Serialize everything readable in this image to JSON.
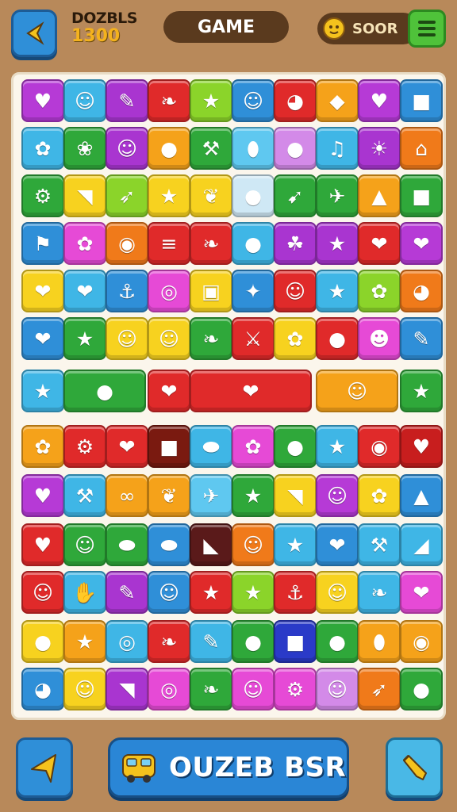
{
  "header": {
    "score_title": "DOZBLS",
    "score_value": "1300",
    "game_label": "GAME",
    "coin_label": "SOOR"
  },
  "footer": {
    "main_label": "OUZEB BSR"
  },
  "colors": {
    "background": "#b8895a",
    "board": "#fbf6ec",
    "primary_button": "#2a86d6",
    "menu_button": "#4fc23a"
  },
  "board": {
    "rows": [
      [
        {
          "c": "#b63ad6",
          "i": "heart"
        },
        {
          "c": "#3fb6e6",
          "i": "cat"
        },
        {
          "c": "#a935d0",
          "i": "pencil"
        },
        {
          "c": "#e02a2a",
          "i": "leaf"
        },
        {
          "c": "#8bd42a",
          "i": "star"
        },
        {
          "c": "#2f8fd8",
          "i": "face"
        },
        {
          "c": "#e02a2a",
          "i": "robot"
        },
        {
          "c": "#f5a21a",
          "i": "diamond"
        },
        {
          "c": "#b63ad6",
          "i": "heart"
        },
        {
          "c": "#2f8fd8",
          "i": "square"
        }
      ],
      [
        {
          "c": "#3fb6e6",
          "i": "flower"
        },
        {
          "c": "#2fa83a",
          "i": "drumstick"
        },
        {
          "c": "#a935d0",
          "i": "face"
        },
        {
          "c": "#f5a21a",
          "i": "drop"
        },
        {
          "c": "#2fa83a",
          "i": "shovel"
        },
        {
          "c": "#5fc8f0",
          "i": "egg"
        },
        {
          "c": "#d38ae8",
          "i": "circle"
        },
        {
          "c": "#3fb6e6",
          "i": "note"
        },
        {
          "c": "#a935d0",
          "i": "bulb"
        },
        {
          "c": "#f07a1a",
          "i": "house"
        }
      ],
      [
        {
          "c": "#2fa83a",
          "i": "gear"
        },
        {
          "c": "#f7d21f",
          "i": "boot"
        },
        {
          "c": "#8bd42a",
          "i": "carrot"
        },
        {
          "c": "#f7d21f",
          "i": "star"
        },
        {
          "c": "#f7d21f",
          "i": "paw"
        },
        {
          "c": "#cfe8f5",
          "i": "drop"
        },
        {
          "c": "#2fa83a",
          "i": "arrow"
        },
        {
          "c": "#2fa83a",
          "i": "rocket"
        },
        {
          "c": "#f5a21a",
          "i": "acorn"
        },
        {
          "c": "#2fa83a",
          "i": "square"
        }
      ],
      [
        {
          "c": "#2f8fd8",
          "i": "flag"
        },
        {
          "c": "#e64ad6",
          "i": "flower"
        },
        {
          "c": "#f07a1a",
          "i": "disc"
        },
        {
          "c": "#e02a2a",
          "i": "lines"
        },
        {
          "c": "#e02a2a",
          "i": "leaf"
        },
        {
          "c": "#3fb6e6",
          "i": "ball"
        },
        {
          "c": "#a935d0",
          "i": "map"
        },
        {
          "c": "#a935d0",
          "i": "star"
        },
        {
          "c": "#e02a2a",
          "i": "apple"
        },
        {
          "c": "#b63ad6",
          "i": "apple"
        }
      ],
      [
        {
          "c": "#f7d21f",
          "i": "apple"
        },
        {
          "c": "#3fb6e6",
          "i": "apple"
        },
        {
          "c": "#2f8fd8",
          "i": "hook"
        },
        {
          "c": "#e64ad6",
          "i": "target"
        },
        {
          "c": "#f7d21f",
          "i": "box"
        },
        {
          "c": "#2f8fd8",
          "i": "bone"
        },
        {
          "c": "#e02a2a",
          "i": "face"
        },
        {
          "c": "#3fb6e6",
          "i": "star"
        },
        {
          "c": "#8bd42a",
          "i": "flower"
        },
        {
          "c": "#f07a1a",
          "i": "robot"
        }
      ],
      [
        {
          "c": "#2f8fd8",
          "i": "apple"
        },
        {
          "c": "#2fa83a",
          "i": "star"
        },
        {
          "c": "#f7d21f",
          "i": "face"
        },
        {
          "c": "#f7d21f",
          "i": "face"
        },
        {
          "c": "#2fa83a",
          "i": "leaf"
        },
        {
          "c": "#e02a2a",
          "i": "axe"
        },
        {
          "c": "#f7d21f",
          "i": "flower"
        },
        {
          "c": "#e02a2a",
          "i": "circle"
        },
        {
          "c": "#e64ad6",
          "i": "pig"
        },
        {
          "c": "#2f8fd8",
          "i": "pencil"
        }
      ],
      [
        {
          "c": "#3fb6e6",
          "i": "star"
        },
        {
          "c": "#2fa83a",
          "i": "drop"
        },
        {
          "c": "#e02a2a",
          "i": "apple"
        },
        {
          "c": "#e02a2a",
          "i": "apple"
        },
        {
          "c": "#f5a21a",
          "i": "face"
        },
        {
          "c": "#2fa83a",
          "i": "star"
        }
      ],
      [
        {
          "c": "#f5a21a",
          "i": "flower"
        },
        {
          "c": "#e02a2a",
          "i": "gear"
        },
        {
          "c": "#e02a2a",
          "i": "apple"
        },
        {
          "c": "#7a1a10",
          "i": "square"
        },
        {
          "c": "#3fb6e6",
          "i": "pill"
        },
        {
          "c": "#e64ad6",
          "i": "flower"
        },
        {
          "c": "#2fa83a",
          "i": "circle"
        },
        {
          "c": "#3fb6e6",
          "i": "star"
        },
        {
          "c": "#e02a2a",
          "i": "disc"
        },
        {
          "c": "#c81e1e",
          "i": "heart"
        }
      ],
      [
        {
          "c": "#b63ad6",
          "i": "heart"
        },
        {
          "c": "#3fb6e6",
          "i": "shovel"
        },
        {
          "c": "#f5a21a",
          "i": "peanut"
        },
        {
          "c": "#f5a21a",
          "i": "paw"
        },
        {
          "c": "#5fc8f0",
          "i": "plane"
        },
        {
          "c": "#2fa83a",
          "i": "star"
        },
        {
          "c": "#f7d21f",
          "i": "boot"
        },
        {
          "c": "#b63ad6",
          "i": "cat"
        },
        {
          "c": "#f7d21f",
          "i": "flower"
        },
        {
          "c": "#2f8fd8",
          "i": "cake"
        }
      ],
      [
        {
          "c": "#e02a2a",
          "i": "heart"
        },
        {
          "c": "#2fa83a",
          "i": "face"
        },
        {
          "c": "#2fa83a",
          "i": "pill"
        },
        {
          "c": "#2f8fd8",
          "i": "pill"
        },
        {
          "c": "#5a1a1a",
          "i": "paper"
        },
        {
          "c": "#f07a1a",
          "i": "person"
        },
        {
          "c": "#3fb6e6",
          "i": "star"
        },
        {
          "c": "#2f8fd8",
          "i": "apple"
        },
        {
          "c": "#3fb6e6",
          "i": "shovel"
        },
        {
          "c": "#3fb6e6",
          "i": "cheese"
        }
      ],
      [
        {
          "c": "#e02a2a",
          "i": "face"
        },
        {
          "c": "#3fb6e6",
          "i": "hand"
        },
        {
          "c": "#a935d0",
          "i": "pencil"
        },
        {
          "c": "#2f8fd8",
          "i": "face"
        },
        {
          "c": "#e02a2a",
          "i": "star"
        },
        {
          "c": "#8bd42a",
          "i": "star"
        },
        {
          "c": "#e02a2a",
          "i": "hook"
        },
        {
          "c": "#f7d21f",
          "i": "person"
        },
        {
          "c": "#3fb6e6",
          "i": "pepper"
        },
        {
          "c": "#e64ad6",
          "i": "apple"
        }
      ],
      [
        {
          "c": "#f7d21f",
          "i": "ball"
        },
        {
          "c": "#f5a21a",
          "i": "star"
        },
        {
          "c": "#3fb6e6",
          "i": "target"
        },
        {
          "c": "#e02a2a",
          "i": "leaf"
        },
        {
          "c": "#3fb6e6",
          "i": "pencil"
        },
        {
          "c": "#2fa83a",
          "i": "circle"
        },
        {
          "c": "#2a3ac8",
          "i": "square"
        },
        {
          "c": "#2fa83a",
          "i": "circle"
        },
        {
          "c": "#f5a21a",
          "i": "egg"
        },
        {
          "c": "#f5a21a",
          "i": "disc"
        }
      ],
      [
        {
          "c": "#2f8fd8",
          "i": "robot"
        },
        {
          "c": "#f7d21f",
          "i": "person"
        },
        {
          "c": "#a935d0",
          "i": "boot"
        },
        {
          "c": "#e64ad6",
          "i": "target"
        },
        {
          "c": "#2fa83a",
          "i": "leaf"
        },
        {
          "c": "#e64ad6",
          "i": "face"
        },
        {
          "c": "#e64ad6",
          "i": "gear"
        },
        {
          "c": "#d38ae8",
          "i": "person"
        },
        {
          "c": "#f07a1a",
          "i": "carrot"
        },
        {
          "c": "#2fa83a",
          "i": "ball"
        }
      ]
    ]
  }
}
